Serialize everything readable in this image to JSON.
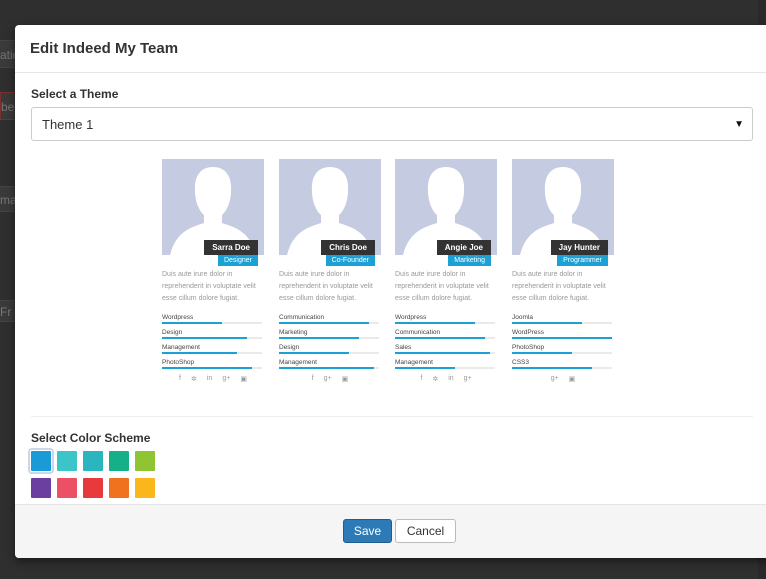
{
  "background": {
    "fragments": [
      "atio",
      "bel",
      "ma",
      "Fr"
    ]
  },
  "modal": {
    "title": "Edit Indeed My Team",
    "theme_label": "Select a Theme",
    "theme_value": "Theme 1",
    "color_label": "Select Color Scheme",
    "save_label": "Save",
    "cancel_label": "Cancel"
  },
  "team": [
    {
      "name": "Sarra Doe",
      "role": "Designer",
      "bio": "Duis aute irure dolor in reprehenderit in voluptate velit esse cillum dolore fugiat.",
      "skills": [
        {
          "label": "Wordpress",
          "level": 0.6
        },
        {
          "label": "Design",
          "level": 0.85
        },
        {
          "label": "Management",
          "level": 0.75
        },
        {
          "label": "PhotoShop",
          "level": 0.9
        }
      ],
      "socials": [
        "f",
        "t",
        "in",
        "g+",
        "ig"
      ]
    },
    {
      "name": "Chris Doe",
      "role": "Co-Founder",
      "bio": "Duis aute irure dolor in reprehenderit in voluptate velit esse cillum dolore fugiat.",
      "skills": [
        {
          "label": "Communication",
          "level": 0.9
        },
        {
          "label": "Marketing",
          "level": 0.8
        },
        {
          "label": "Design",
          "level": 0.7
        },
        {
          "label": "Management",
          "level": 0.95
        }
      ],
      "socials": [
        "f",
        "g+",
        "ig"
      ]
    },
    {
      "name": "Angie Joe",
      "role": "Marketing",
      "bio": "Duis aute irure dolor in reprehenderit in voluptate velit esse cillum dolore fugiat.",
      "skills": [
        {
          "label": "Wordpress",
          "level": 0.8
        },
        {
          "label": "Communication",
          "level": 0.9
        },
        {
          "label": "Sales",
          "level": 0.95
        },
        {
          "label": "Management",
          "level": 0.6
        }
      ],
      "socials": [
        "f",
        "t",
        "in",
        "g+"
      ]
    },
    {
      "name": "Jay Hunter",
      "role": "Programmer",
      "bio": "Duis aute irure dolor in reprehenderit in voluptate velit esse cillum dolore fugiat.",
      "skills": [
        {
          "label": "Joomla",
          "level": 0.7
        },
        {
          "label": "WordPress",
          "level": 1.0
        },
        {
          "label": "PhotoShop",
          "level": 0.6
        },
        {
          "label": "CSS3",
          "level": 0.8
        }
      ],
      "socials": [
        "g+",
        "ig"
      ]
    }
  ],
  "colors": {
    "accent": "#1ba1d6",
    "swatches_row1": [
      "#1a9ad6",
      "#3cc5c9",
      "#2bb5be",
      "#16b088",
      "#8fc432"
    ],
    "swatches_row2": [
      "#6b3fa0",
      "#ec5064",
      "#e8393d",
      "#f0721e",
      "#f9b71c"
    ],
    "selected_index": 0
  }
}
